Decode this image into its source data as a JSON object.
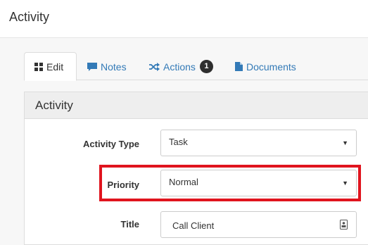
{
  "page": {
    "title": "Activity"
  },
  "tabs": [
    {
      "label": "Edit",
      "icon": "grid-icon",
      "active": true
    },
    {
      "label": "Notes",
      "icon": "comment-icon",
      "active": false
    },
    {
      "label": "Actions",
      "icon": "shuffle-icon",
      "badge": "1",
      "active": false
    },
    {
      "label": "Documents",
      "icon": "document-icon",
      "active": false
    }
  ],
  "panel": {
    "heading": "Activity"
  },
  "form": {
    "activity_type": {
      "label": "Activity Type",
      "value": "Task"
    },
    "priority": {
      "label": "Priority",
      "value": "Normal",
      "highlighted": true
    },
    "title": {
      "label": "Title",
      "value": "Call Client"
    }
  },
  "colors": {
    "link": "#337ab7",
    "highlight": "#e0141e",
    "badge": "#2e2e2e"
  }
}
